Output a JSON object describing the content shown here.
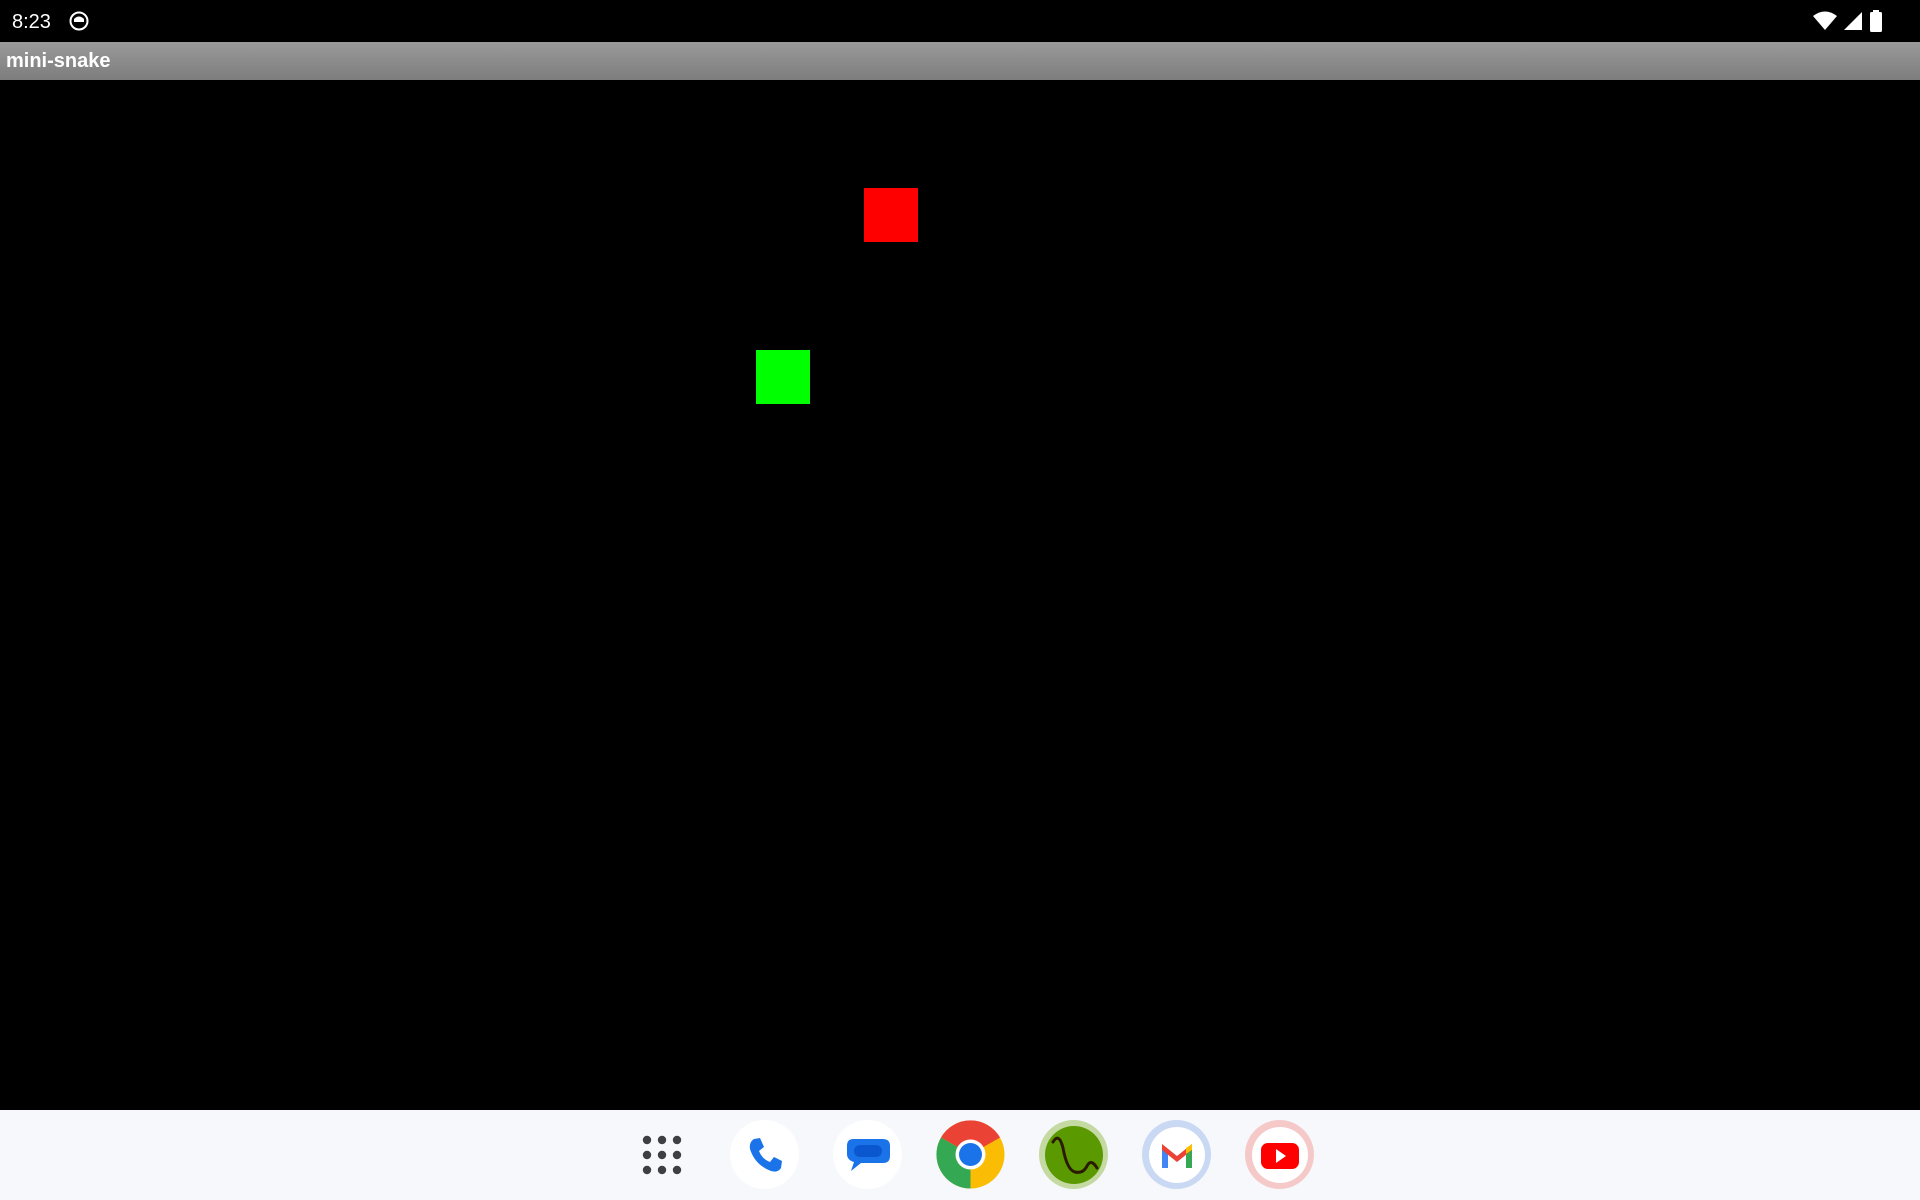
{
  "status_bar": {
    "time": "8:23",
    "icons": [
      "notification-icon",
      "wifi-icon",
      "signal-icon",
      "battery-icon"
    ]
  },
  "window": {
    "title": "mini-snake"
  },
  "game": {
    "background_color": "#000000",
    "food_color": "#ff0000",
    "snake_color": "#00ff00",
    "food": {
      "col": 16,
      "row": 2
    },
    "snake": [
      {
        "col": 14,
        "row": 5
      }
    ]
  },
  "dock": {
    "apps": [
      "app-drawer-icon",
      "phone-icon",
      "messages-icon",
      "chrome-icon",
      "snake-app-icon",
      "gmail-icon",
      "youtube-icon"
    ]
  },
  "colors": {
    "title_bar": "#8c8c8c",
    "dock_background": "#f6f8fc"
  }
}
